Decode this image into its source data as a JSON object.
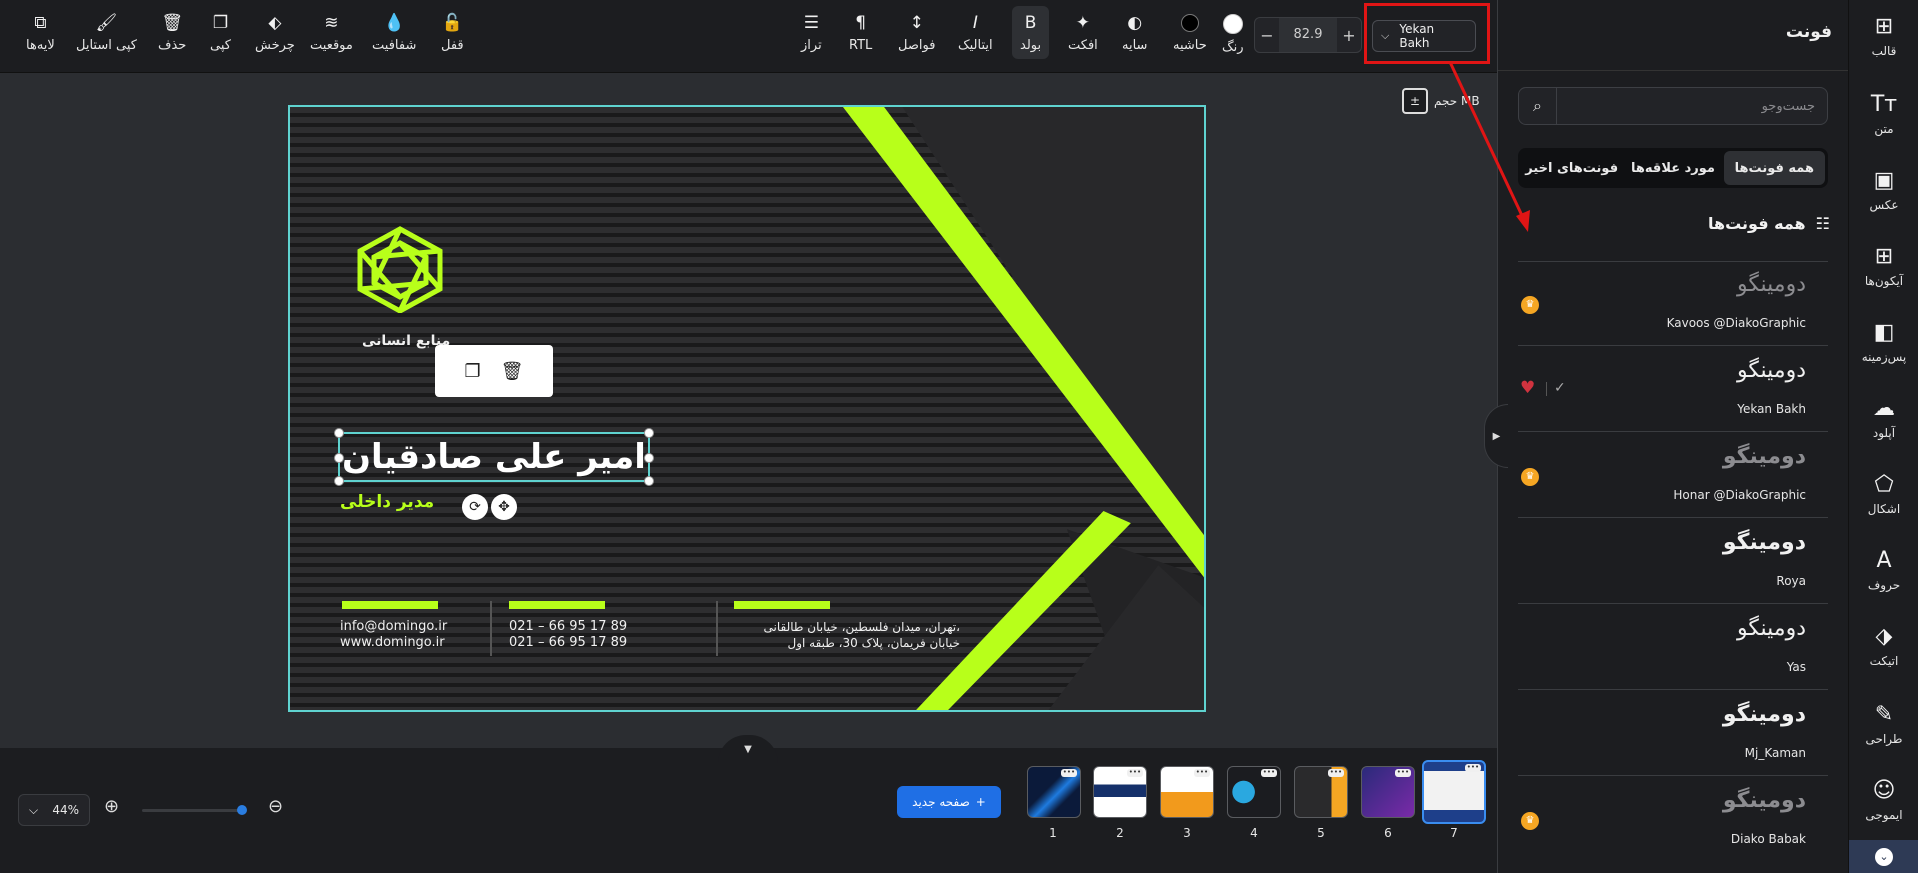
{
  "toolbar": {
    "left_items": [
      {
        "icon": "layers-icon",
        "label": "لایه‌ها"
      },
      {
        "icon": "brush-icon",
        "label": "کپی استایل"
      },
      {
        "icon": "trash-icon",
        "label": "حذف"
      },
      {
        "icon": "copy-icon",
        "label": "کپی"
      },
      {
        "icon": "rotate-icon",
        "label": "چرخش"
      },
      {
        "icon": "position-icon",
        "label": "موقعیت"
      },
      {
        "icon": "opacity-icon",
        "label": "شفافیت"
      },
      {
        "icon": "lock-icon",
        "label": "قفل"
      }
    ],
    "right_items": [
      {
        "icon": "align-icon",
        "label": "تراز"
      },
      {
        "icon": "rtl-icon",
        "label": "RTL"
      },
      {
        "icon": "spacing-icon",
        "label": "فواصل"
      },
      {
        "icon": "italic-icon",
        "label": "ایتالیک"
      },
      {
        "icon": "bold-icon",
        "label": "بولد"
      },
      {
        "icon": "effect-icon",
        "label": "افکت"
      },
      {
        "icon": "shadow-icon",
        "label": "سایه"
      },
      {
        "icon": "border-icon",
        "label": "حاشیه"
      },
      {
        "icon": "color-icon",
        "label": "رنگ"
      }
    ],
    "font_size": "82.9",
    "font_name": "Yekan Bakh",
    "minus": "−",
    "plus": "+"
  },
  "rail": [
    {
      "icon": "template-icon",
      "label": "قالب"
    },
    {
      "icon": "text-icon",
      "label": "متن"
    },
    {
      "icon": "image-icon",
      "label": "عکس"
    },
    {
      "icon": "icons-icon",
      "label": "آیکون‌ها"
    },
    {
      "icon": "background-icon",
      "label": "پس‌زمینه"
    },
    {
      "icon": "upload-icon",
      "label": "آپلود"
    },
    {
      "icon": "shapes-icon",
      "label": "اشکال"
    },
    {
      "icon": "letters-icon",
      "label": "حروف"
    },
    {
      "icon": "sticker-icon",
      "label": "اتیکت"
    },
    {
      "icon": "design-icon",
      "label": "طراحی"
    },
    {
      "icon": "emoji-icon",
      "label": "ایموجی"
    }
  ],
  "panel": {
    "title": "فونت",
    "search_placeholder": "جست‌وجو",
    "tabs": [
      "همه فونت‌ها",
      "مورد علاقه‌ها",
      "فونت‌های اخیر"
    ],
    "section_title": "همه فونت‌ها",
    "fonts": [
      {
        "sample": "دومینگو",
        "name": "Kavoos @DiakoGraphic",
        "premium": true,
        "favorite": false
      },
      {
        "sample": "دومینگو",
        "name": "Yekan Bakh",
        "premium": false,
        "favorite": true
      },
      {
        "sample": "دومینگو",
        "name": "Honar @DiakoGraphic",
        "premium": true,
        "favorite": false
      },
      {
        "sample": "دومینگو",
        "name": "Roya",
        "premium": false,
        "favorite": false
      },
      {
        "sample": "دومینگو",
        "name": "Yas",
        "premium": false,
        "favorite": false
      },
      {
        "sample": "دومینگو",
        "name": "Mj_Kaman",
        "premium": false,
        "favorite": false
      },
      {
        "sample": "دومینگو",
        "name": "Diako Babak",
        "premium": true,
        "favorite": false
      }
    ]
  },
  "canvas": {
    "size_label": "حجم MB",
    "card": {
      "logo_text": "منابع انسانی",
      "name": "امیر علی صادقیان",
      "job_title": "مدیر داخلی",
      "contact_web": [
        "info@domingo.ir",
        "www.domingo.ir"
      ],
      "contact_phone": [
        "021 – 66 95 17 89",
        "021 – 66 95 17 89"
      ],
      "contact_address": [
        "تهران، میدان فلسطین، خیابان طالقانی،",
        "خیابان فریمان، پلاک 30، طبقه اول"
      ],
      "accent_color": "#b8ff1a"
    }
  },
  "bottom": {
    "zoom": "44%",
    "new_page": "صفحه جدید",
    "pages": [
      "1",
      "2",
      "3",
      "4",
      "5",
      "6",
      "7"
    ],
    "active_page": "7"
  }
}
